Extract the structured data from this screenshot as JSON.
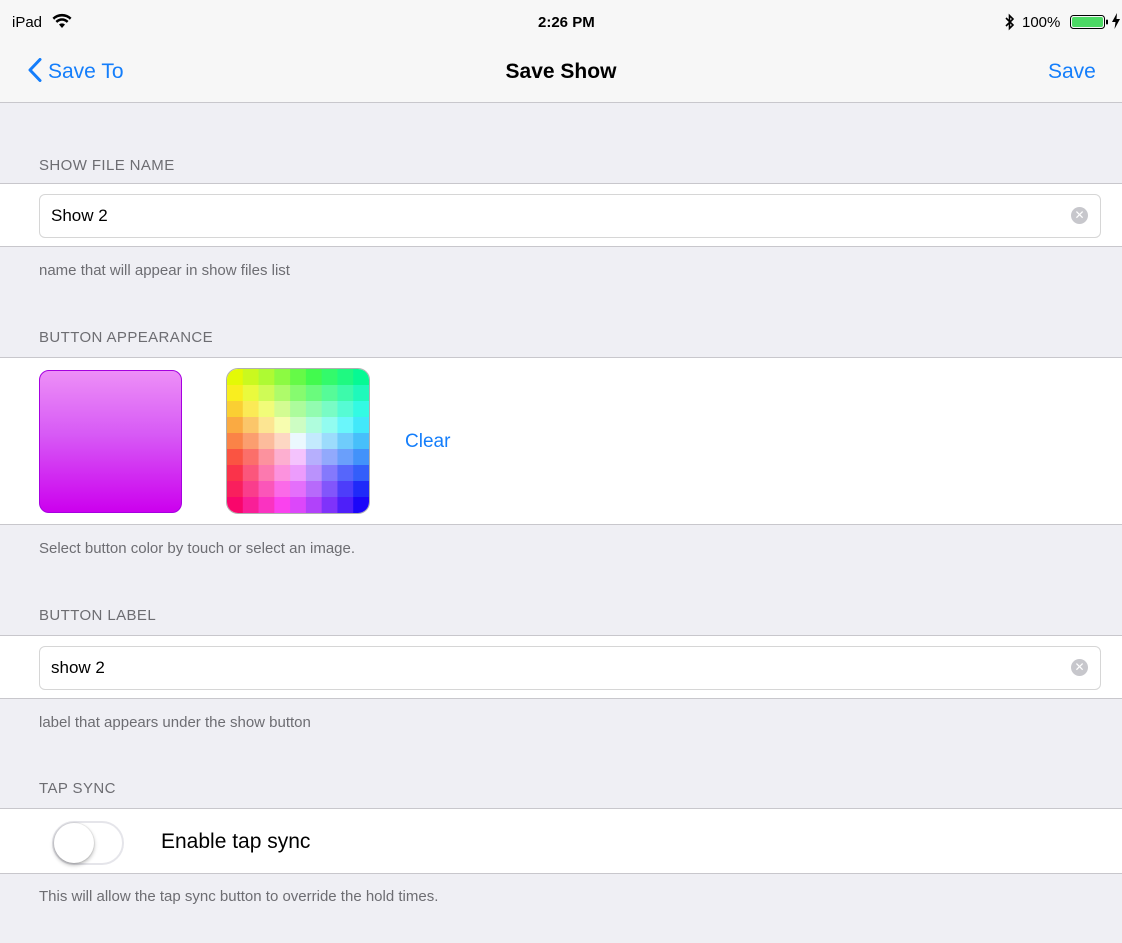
{
  "status_bar": {
    "device": "iPad",
    "time": "2:26 PM",
    "battery": "100%",
    "icons": [
      "wifi-icon",
      "bluetooth-icon",
      "battery-icon",
      "charging-icon"
    ]
  },
  "nav": {
    "back_label": "Save To",
    "title": "Save Show",
    "save_label": "Save"
  },
  "sections": {
    "file_name": {
      "header": "SHOW FILE NAME",
      "value": "Show 2",
      "footer": "name that will appear in show files list"
    },
    "appearance": {
      "header": "BUTTON APPEARANCE",
      "clear_label": "Clear",
      "footer": "Select button color by touch or select an image."
    },
    "label": {
      "header": "BUTTON LABEL",
      "value": "show 2",
      "footer": "label that appears under the show button"
    },
    "tap_sync": {
      "header": "TAP SYNC",
      "toggle_label": "Enable tap sync",
      "enabled": false,
      "footer": "This will allow the tap sync button to override the hold times."
    }
  },
  "colors": {
    "accent": "#147efb",
    "swatch_top": "#ed8ff7",
    "swatch_bottom": "#cc00ee",
    "background": "#efeff4"
  }
}
